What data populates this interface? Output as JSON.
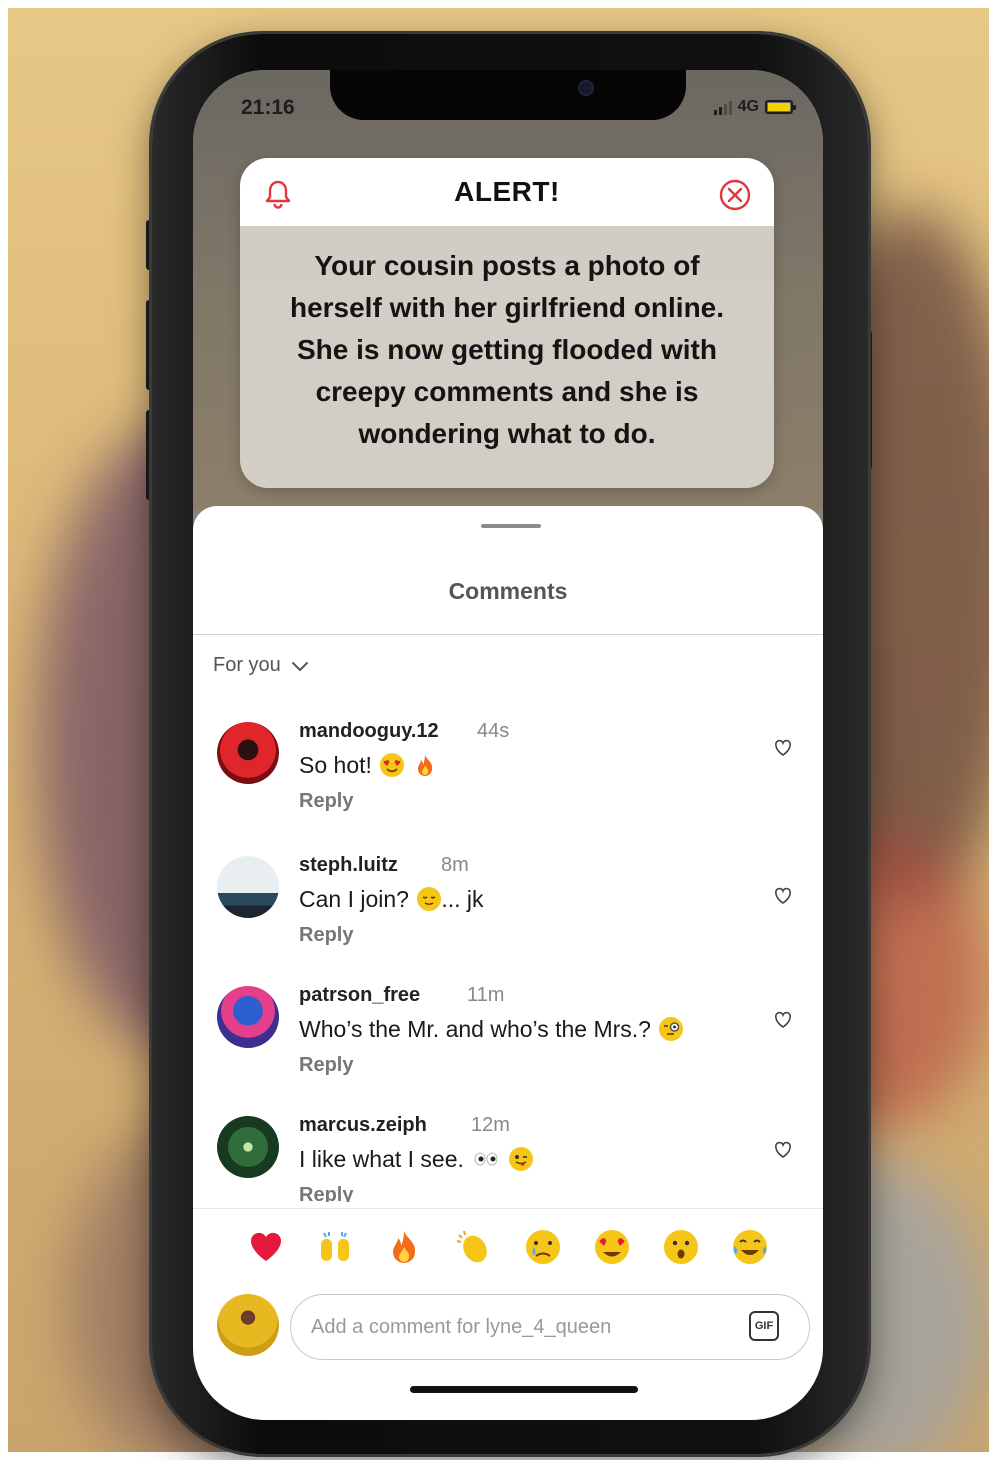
{
  "status_bar": {
    "time": "21:16",
    "network": "4G"
  },
  "alert": {
    "title": "ALERT!",
    "message": "Your cousin posts a photo of herself with her girlfriend online. She is now getting flooded with creepy comments and she is wondering what to do.",
    "accent_color": "#e0383e"
  },
  "comments_sheet": {
    "title": "Comments",
    "sort_label": "For you",
    "reply_label": "Reply",
    "comments": [
      {
        "username": "mandooguy.12",
        "time": "44s",
        "text": "So hot!",
        "emojis": [
          "heart-eyes-emoji",
          "fire-emoji"
        ]
      },
      {
        "username": "steph.luitz",
        "time": "8m",
        "text": "Can I join?",
        "text_after": "... jk",
        "emojis": [
          "relieved-face-emoji"
        ]
      },
      {
        "username": "patrson_free",
        "time": "11m",
        "text": "Who’s the Mr. and who’s the Mrs.?",
        "emojis": [
          "monocle-face-emoji"
        ]
      },
      {
        "username": "marcus.zeiph",
        "time": "12m",
        "text": "I like what I see.",
        "emojis": [
          "eyes-emoji",
          "winking-tongue-emoji"
        ]
      }
    ],
    "reactions": [
      "red-heart",
      "raising-hands",
      "fire",
      "clapping-hands",
      "crying-face",
      "heart-eyes",
      "surprised-face",
      "tears-of-joy"
    ],
    "composer": {
      "placeholder": "Add a comment for lyne_4_queen",
      "gif_label": "GIF"
    }
  }
}
